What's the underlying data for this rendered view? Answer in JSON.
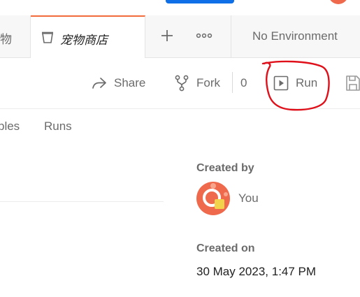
{
  "tabs": {
    "previous_label": "物",
    "active_label": "宠物商店",
    "add_label": "+",
    "more_label": "∘∘∘",
    "environment_label": "No Environment"
  },
  "toolbar": {
    "share_label": "Share",
    "fork_label": "Fork",
    "fork_count": "0",
    "run_label": "Run"
  },
  "subtabs": {
    "variables_label": "ples",
    "runs_label": "Runs"
  },
  "meta": {
    "created_by_heading": "Created by",
    "created_by_value": "You",
    "created_on_heading": "Created on",
    "created_on_value": "30 May 2023, 1:47 PM"
  },
  "colors": {
    "accent_tab": "#f26b3a",
    "primary_button": "#0f6fe6",
    "avatar_red": "#ef6a4c",
    "avatar_yellow": "#f3d24b",
    "annotation": "#e0101a"
  },
  "icons": {
    "tab_icon": "collection-icon",
    "share_icon": "share-arrow-icon",
    "fork_icon": "fork-icon",
    "run_icon": "play-icon",
    "save_icon": "save-icon"
  }
}
